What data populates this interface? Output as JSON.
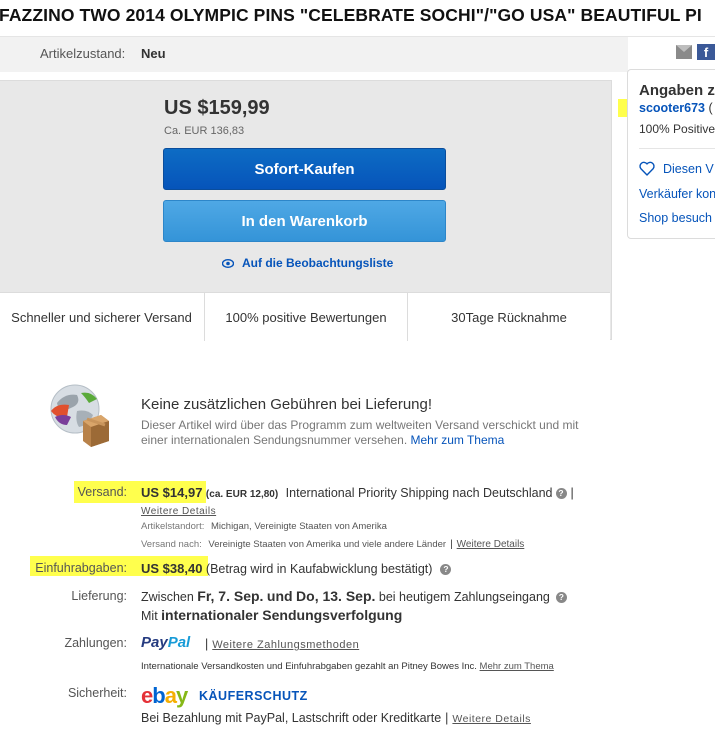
{
  "title": "FAZZINO TWO 2014 OLYMPIC PINS \"CELEBRATE SOCHI\"/\"GO USA\" BEAUTIFUL PI",
  "condition": {
    "label": "Artikelzustand:",
    "value": "Neu"
  },
  "share_icons": [
    "mail-icon",
    "facebook-icon"
  ],
  "buy_box": {
    "price": "US $159,99",
    "price_converted_prefix": "Ca.",
    "price_converted": "EUR 136,83",
    "buy_now_label": "Sofort-Kaufen",
    "add_to_cart_label": "In den Warenkorb",
    "watch_label": "Auf die Beobachtungsliste",
    "features": [
      "Schneller und sicherer Versand",
      "100% positive Bewertungen",
      "30Tage Rücknahme"
    ]
  },
  "seller_panel": {
    "title": "Angaben z",
    "seller_name": "scooter673",
    "seller_name_suffix": " (",
    "positive": "100% Positive",
    "save_seller": "Diesen V",
    "contact": "Verkäufer kon",
    "shop": "Shop besuch"
  },
  "free_shipping": {
    "title": "Keine zusätzlichen Gebühren bei Lieferung!",
    "text": "Dieser Artikel wird über das Programm zum weltweiten Versand verschickt und mit einer internationalen Sendungsnummer versehen.",
    "link": "Mehr zum Thema"
  },
  "shipping": {
    "label": "Versand:",
    "price": "US $14,97",
    "converted": "(ca. EUR 12,80)",
    "service": "International Priority Shipping nach Deutschland",
    "details_link": "Weitere Details",
    "location_label": "Artikelstandort:",
    "location_value": "Michigan, Vereinigte Staaten von Amerika",
    "shipto_label": "Versand nach:",
    "shipto_value": "Vereinigte Staaten von Amerika und viele andere Länder",
    "shipto_link": "Weitere Details"
  },
  "import": {
    "label": "Einfuhrabgaben:",
    "price": "US $38,40",
    "note": "(Betrag wird in Kaufabwicklung bestätigt)"
  },
  "delivery": {
    "label": "Lieferung:",
    "prefix": "Zwischen",
    "from": "Fr, 7. Sep.",
    "and": "und",
    "to": "Do, 13. Sep.",
    "suffix": "bei heutigem Zahlungseingang",
    "line2_prefix": "Mit",
    "line2_bold": "internationaler Sendungsverfolgung"
  },
  "payments": {
    "label": "Zahlungen:",
    "paypal_pay": "Pay",
    "paypal_pal": "Pal",
    "more_link": "Weitere Zahlungsmethoden",
    "note": "Internationale Versandkosten und Einfuhrabgaben gezahlt an Pitney Bowes Inc.",
    "note_link": "Mehr zum Thema"
  },
  "security": {
    "label": "Sicherheit:",
    "ebay_letters": [
      "e",
      "b",
      "a",
      "y"
    ],
    "kaeuferschutz": "KÄUFERSCHUTZ",
    "text": "Bei Bezahlung mit PayPal, Lastschrift oder Kreditkarte",
    "link": "Weitere Details"
  },
  "colors": {
    "buy_button": "#0654ba",
    "cart_button": "#3494d8",
    "link": "#0654ba",
    "highlight": "#ffff4d"
  }
}
